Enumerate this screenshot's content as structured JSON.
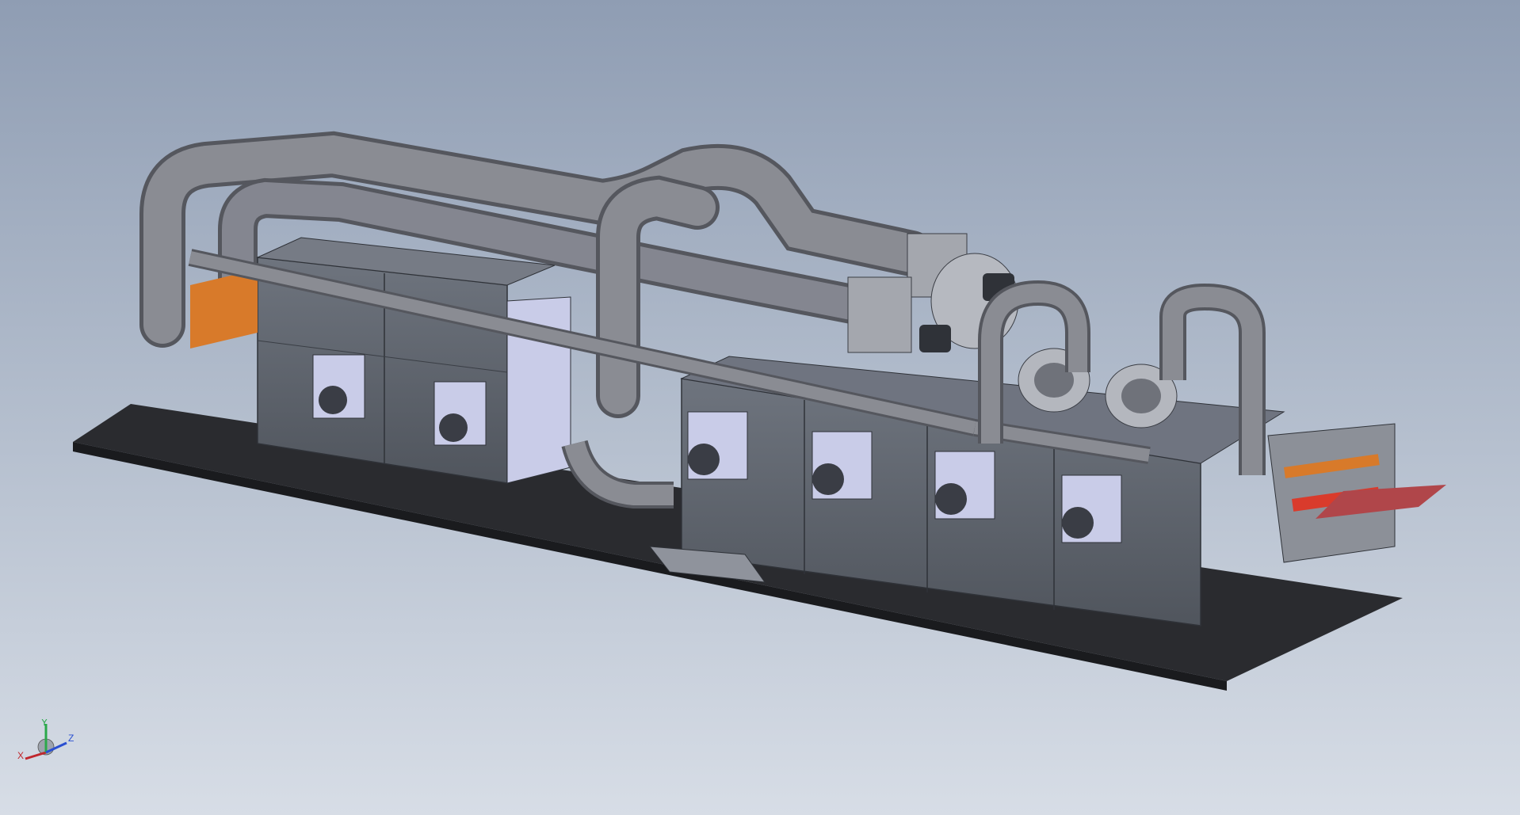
{
  "viewport": {
    "background_top": "#8f9db3",
    "background_bottom": "#d7dde6"
  },
  "model": {
    "parts": [
      "base-plate",
      "dryer-chamber-left",
      "dryer-chamber-right",
      "ducting-upper",
      "ducting-lower",
      "blower-fans",
      "motors",
      "outlet-roller-unit"
    ],
    "colors": {
      "base_plate": "#2a2b2f",
      "chamber_panel": "#646a74",
      "chamber_panel_dark": "#4d5259",
      "duct": "#7d7f86",
      "duct_dark": "#5e6068",
      "interior_light": "#c9cce8",
      "conveyor_orange": "#d87a2a",
      "sheet_red": "#b0464a",
      "roller_red": "#d93b2c"
    }
  },
  "triad": {
    "x_label": "X",
    "y_label": "Y",
    "z_label": "Z",
    "x_color": "#c0272d",
    "y_color": "#2aa84a",
    "z_color": "#2a4fd1"
  }
}
